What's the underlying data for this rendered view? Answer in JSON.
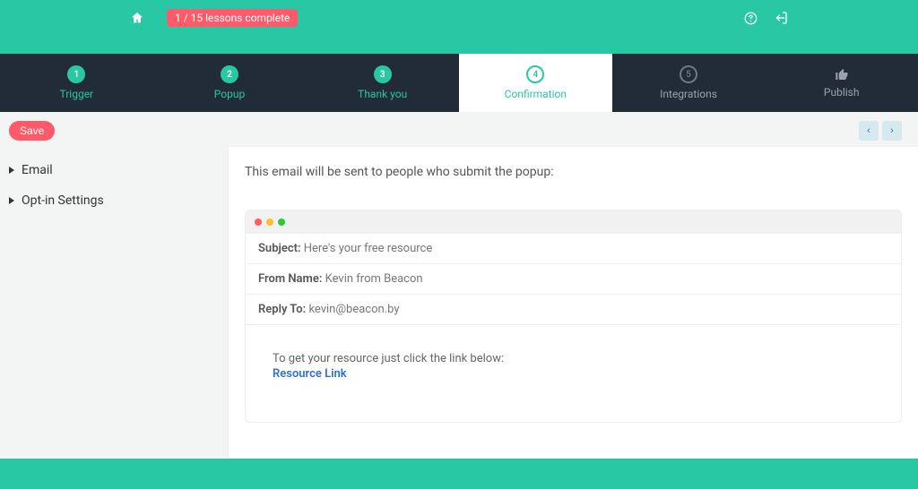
{
  "topbar": {
    "lessons_badge": "1 / 15 lessons complete"
  },
  "steps": [
    {
      "num": "1",
      "label": "Trigger",
      "state": "done"
    },
    {
      "num": "2",
      "label": "Popup",
      "state": "done"
    },
    {
      "num": "3",
      "label": "Thank you",
      "state": "done"
    },
    {
      "num": "4",
      "label": "Confirmation",
      "state": "active"
    },
    {
      "num": "5",
      "label": "Integrations",
      "state": "future"
    },
    {
      "num": "",
      "label": "Publish",
      "state": "future",
      "icon": "thumb"
    }
  ],
  "toolbar": {
    "save": "Save"
  },
  "sidebar": {
    "items": [
      {
        "label": "Email"
      },
      {
        "label": "Opt-in Settings"
      }
    ]
  },
  "main": {
    "intro": "This email will be sent to people who submit the popup:",
    "mail": {
      "subject_label": "Subject:",
      "subject_value": "Here's your free resource",
      "from_label": "From Name:",
      "from_value": "Kevin from Beacon",
      "reply_label": "Reply To:",
      "reply_value": "kevin@beacon.by",
      "body_text": "To get your resource just click the link below:",
      "link_text": "Resource Link"
    }
  }
}
